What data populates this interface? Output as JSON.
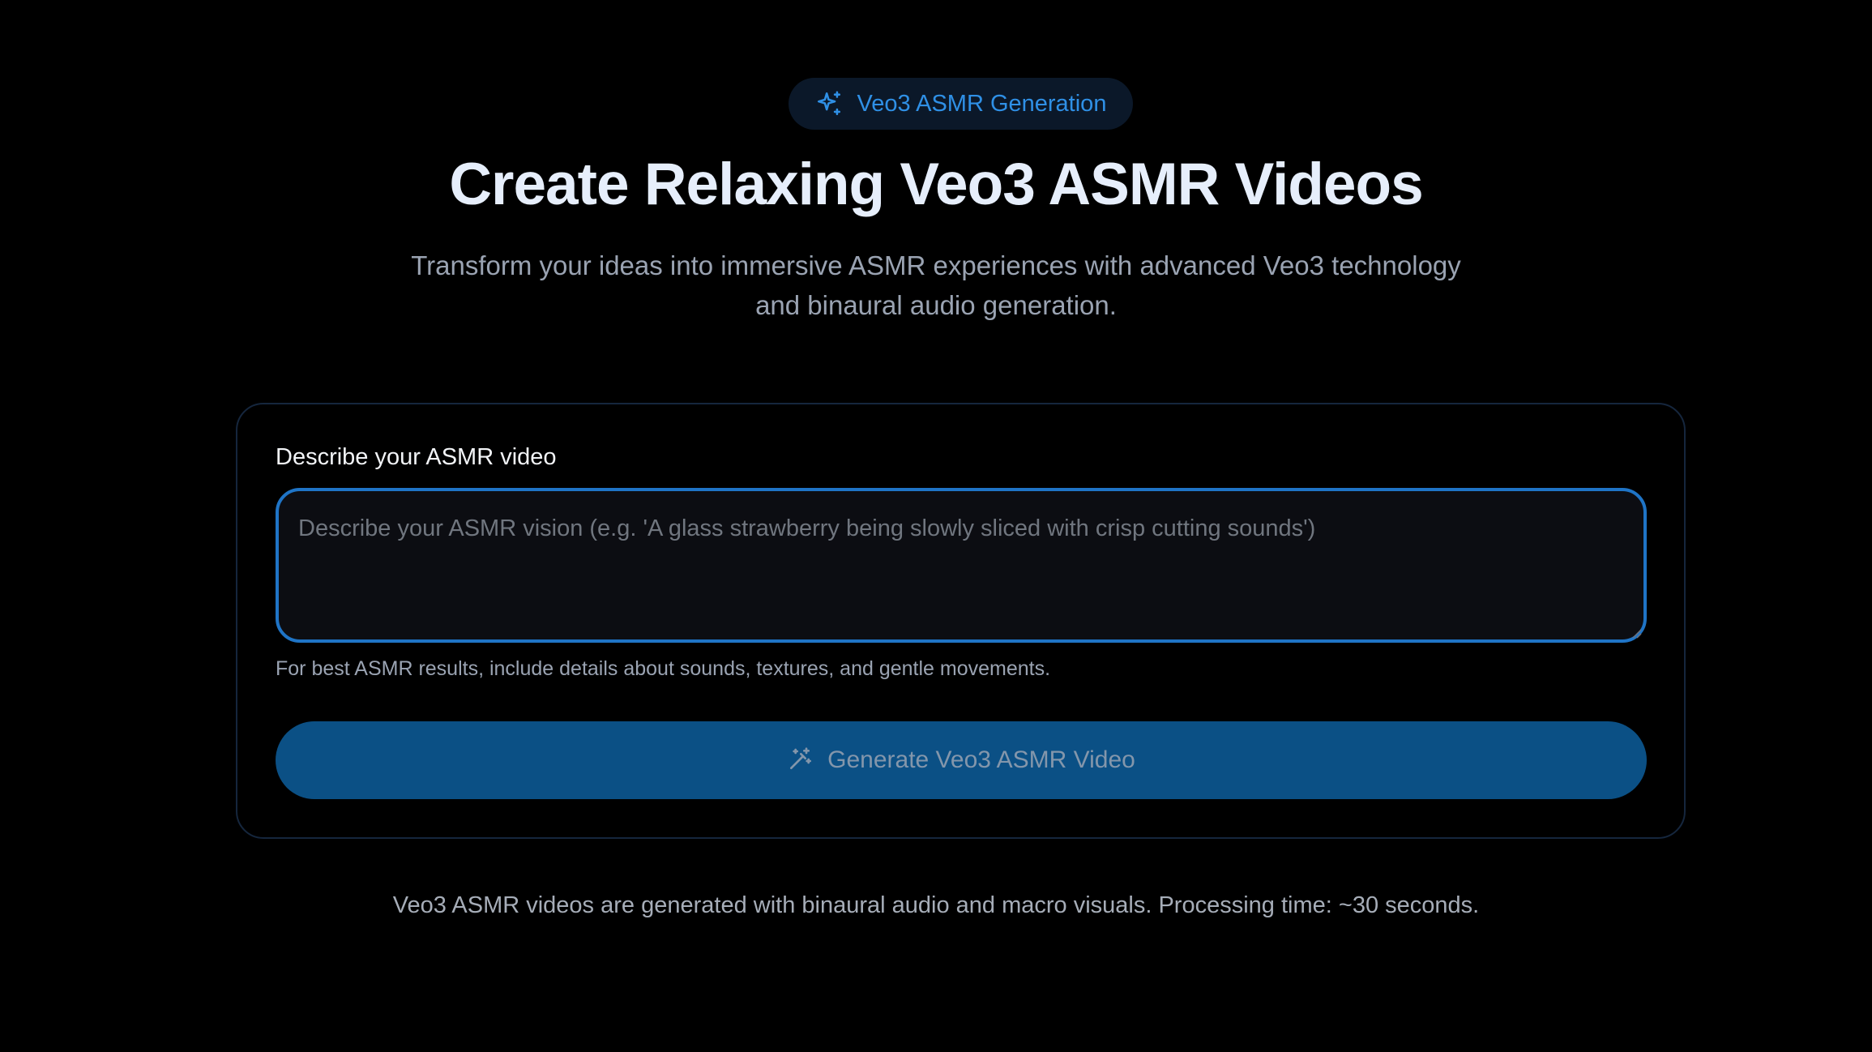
{
  "badge": {
    "icon": "sparkles-icon",
    "label": "Veo3 ASMR Generation"
  },
  "hero": {
    "title": "Create Relaxing Veo3 ASMR Videos",
    "subtitle": "Transform your ideas into immersive ASMR experiences with advanced Veo3 technology and binaural audio generation."
  },
  "form": {
    "label": "Describe your ASMR video",
    "prompt_value": "",
    "prompt_placeholder": "Describe your ASMR vision (e.g. 'A glass strawberry being slowly sliced with crisp cutting sounds')",
    "hint": "For best ASMR results, include details about sounds, textures, and gentle movements.",
    "generate_button": {
      "icon": "magic-wand-icon",
      "label": "Generate Veo3 ASMR Video"
    }
  },
  "footer": {
    "note": "Veo3 ASMR videos are generated with binaural audio and macro visuals. Processing time: ~30 seconds."
  },
  "colors": {
    "background": "#000000",
    "accent": "#2f90e6",
    "button": "#0b5085",
    "input_border": "#1f74c6"
  }
}
